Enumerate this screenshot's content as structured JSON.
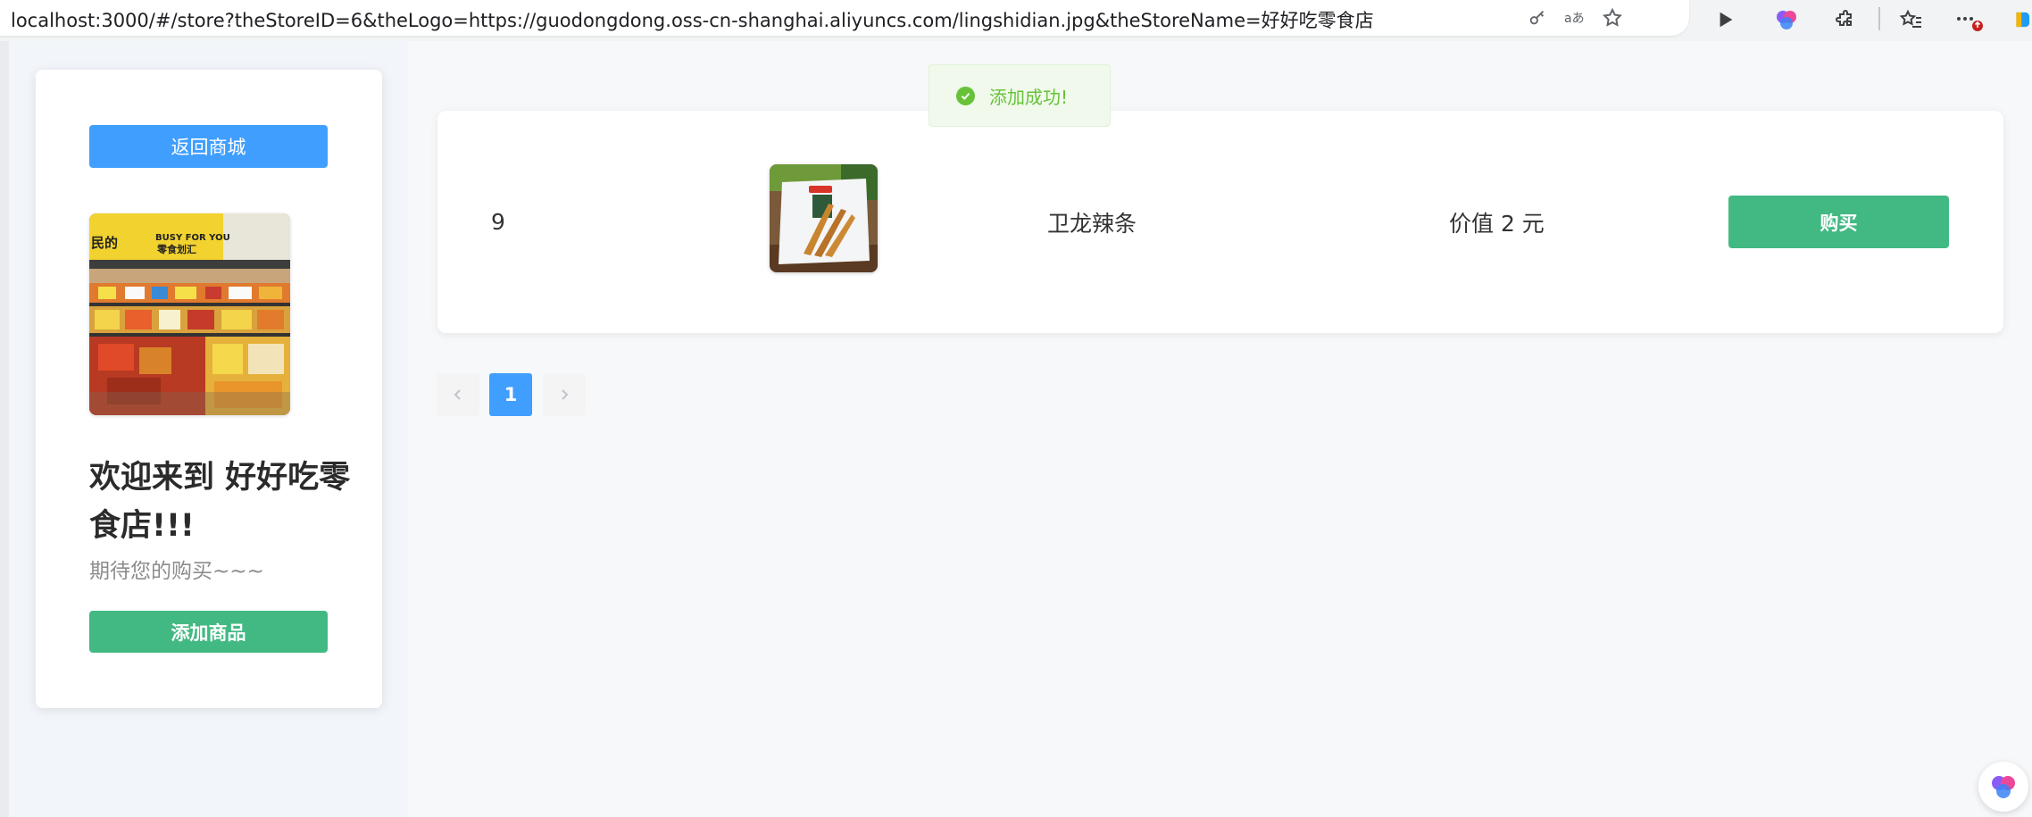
{
  "browser": {
    "url": "localhost:3000/#/store?theStoreID=6&theLogo=https://guodongdong.oss-cn-shanghai.aliyuncs.com/lingshidian.jpg&theStoreName=好好吃零食店"
  },
  "sidebar": {
    "back_label": "返回商城",
    "welcome_title": "欢迎来到 好好吃零食店!!!",
    "welcome_sub": "期待您的购买~~~",
    "add_label": "添加商品"
  },
  "products": [
    {
      "id": "9",
      "name": "卫龙辣条",
      "price_text": "价值 2 元",
      "buy_label": "购买"
    }
  ],
  "pagination": {
    "current_page": "1",
    "prev_icon": "chevron-left-icon",
    "next_icon": "chevron-right-icon"
  },
  "toast": {
    "message": "添加成功!",
    "icon": "check-circle-icon"
  },
  "colors": {
    "primary": "#409eff",
    "success": "#42b983",
    "toast_green": "#67c23a"
  }
}
